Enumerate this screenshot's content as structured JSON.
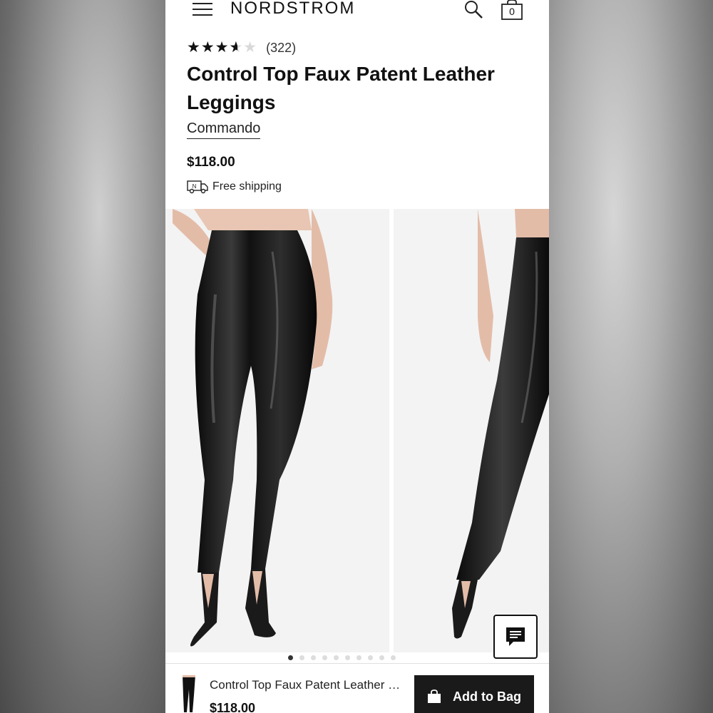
{
  "header": {
    "logo": "NORDSTROM",
    "bag_count": "0"
  },
  "product": {
    "rating": 3.6,
    "review_count": "(322)",
    "title": "Control Top Faux Patent Leather Leggings",
    "brand": "Commando",
    "price": "$118.00",
    "shipping": "Free shipping",
    "truck_badge": "N"
  },
  "gallery": {
    "image_count": 10,
    "active_index": 0
  },
  "bottom_bar": {
    "title": "Control Top Faux Patent Leather Leggings",
    "price": "$118.00",
    "add_to_bag_label": "Add to Bag"
  },
  "colors": {
    "accent": "#1a1a1a",
    "text": "#111111",
    "star_empty": "#d9d9d9"
  }
}
